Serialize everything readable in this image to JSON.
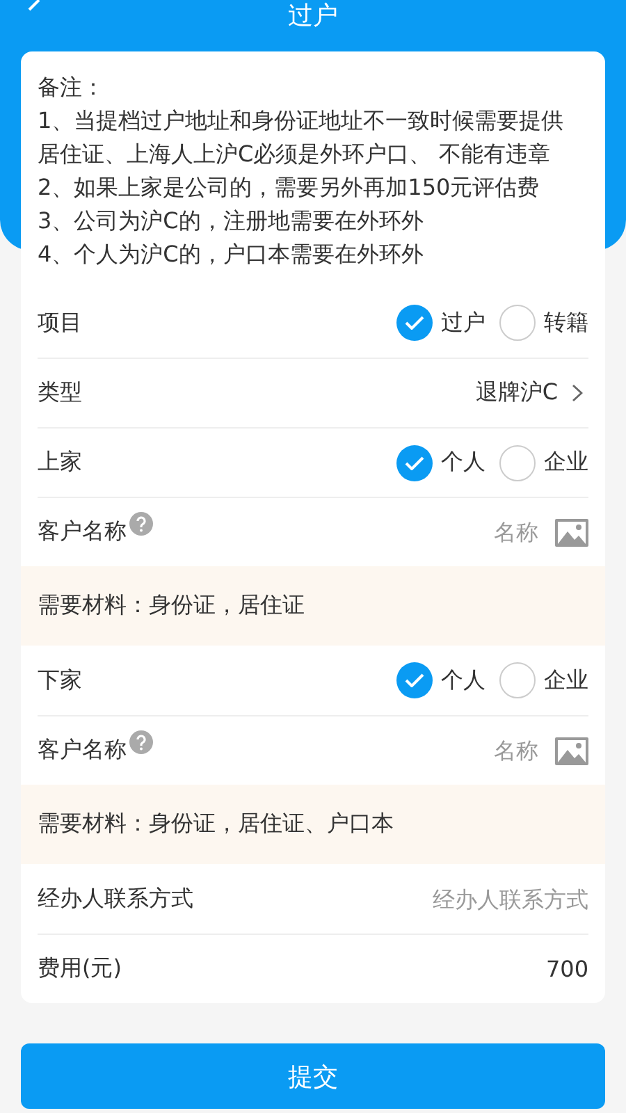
{
  "header": {
    "title": "过户"
  },
  "notes": {
    "heading": "备注：",
    "items": [
      "1、当提档过户地址和身份证地址不一致时候需要提供居住证、上海人上沪C必须是外环户口、 不能有违章",
      "2、如果上家是公司的，需要另外再加150元评估费",
      "3、公司为沪C的，注册地需要在外环外",
      "4、个人为沪C的，户口本需要在外环外"
    ]
  },
  "rows": [
    {
      "kind": "radio",
      "label": "项目",
      "options": [
        {
          "label": "过户",
          "selected": true
        },
        {
          "label": "转籍",
          "selected": false
        }
      ]
    },
    {
      "kind": "select",
      "label": "类型",
      "value": "退牌沪C"
    },
    {
      "kind": "radio",
      "label": "上家",
      "options": [
        {
          "label": "个人",
          "selected": true
        },
        {
          "label": "企业",
          "selected": false
        }
      ]
    },
    {
      "kind": "name",
      "label": "客户名称",
      "placeholder": "名称"
    },
    {
      "kind": "notice",
      "text": "需要材料：身份证，居住证"
    },
    {
      "kind": "radio",
      "label": "下家",
      "options": [
        {
          "label": "个人",
          "selected": true
        },
        {
          "label": "企业",
          "selected": false
        }
      ]
    },
    {
      "kind": "name",
      "label": "客户名称",
      "placeholder": "名称"
    },
    {
      "kind": "notice",
      "text": "需要材料：身份证，居住证、户口本"
    },
    {
      "kind": "input",
      "label": "经办人联系方式",
      "placeholder": "经办人联系方式"
    },
    {
      "kind": "value",
      "label": "费用(元)",
      "value": "700"
    }
  ],
  "submit": "提交"
}
